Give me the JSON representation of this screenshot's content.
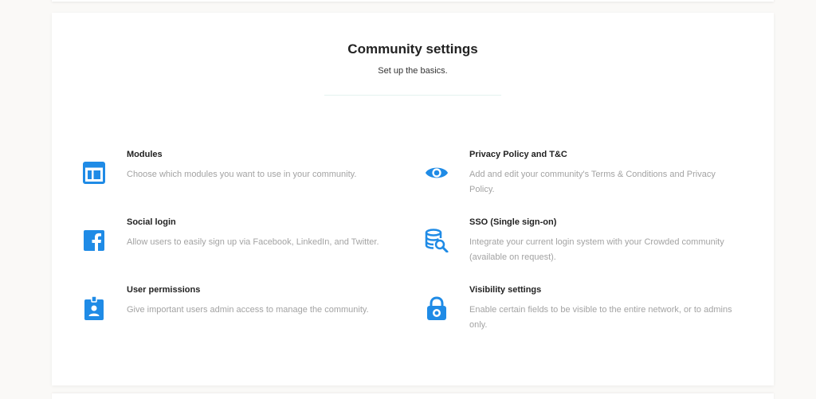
{
  "header": {
    "title": "Community settings",
    "subtitle": "Set up the basics."
  },
  "accent_color": "#1f8be6",
  "items": [
    {
      "icon": "layout-icon",
      "title": "Modules",
      "description": "Choose which modules you want to use in your community."
    },
    {
      "icon": "eye-icon",
      "title": "Privacy Policy and T&C",
      "description": "Add and edit your community's Terms & Conditions and Privacy Policy."
    },
    {
      "icon": "facebook-icon",
      "title": "Social login",
      "description": "Allow users to easily sign up via Facebook, LinkedIn, and Twitter."
    },
    {
      "icon": "database-search-icon",
      "title": "SSO (Single sign-on)",
      "description": "Integrate your current login system with your Crowded community (available on request)."
    },
    {
      "icon": "id-badge-icon",
      "title": "User permissions",
      "description": "Give important users admin access to manage the community."
    },
    {
      "icon": "lock-icon",
      "title": "Visibility settings",
      "description": "Enable certain fields to be visible to the entire network, or to admins only."
    }
  ]
}
